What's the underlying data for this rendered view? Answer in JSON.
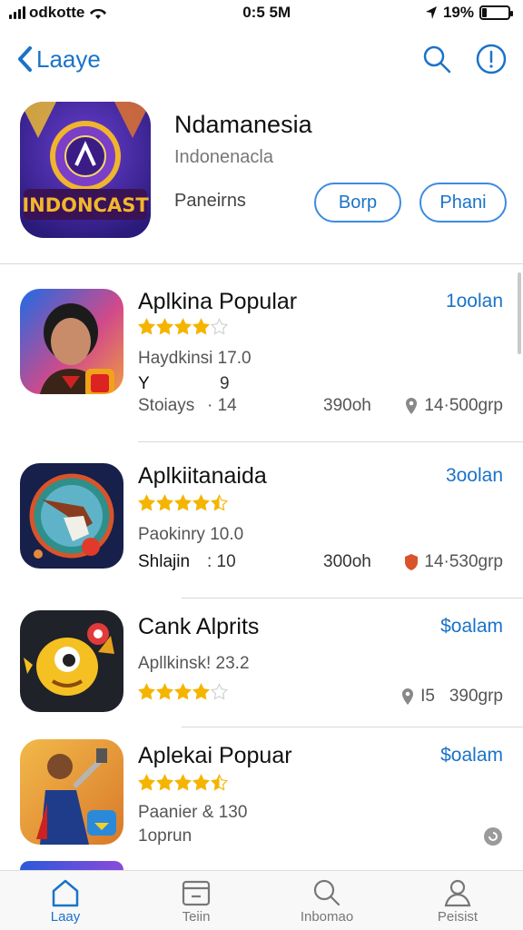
{
  "status": {
    "carrier": "odkotte",
    "time": "0:5 5M",
    "battery": "19%",
    "battery_level": 0.19
  },
  "nav": {
    "back_label": "Laaye"
  },
  "hero": {
    "title": "Ndamanesia",
    "subtitle": "Indonenacla",
    "label": "Paneirns",
    "button_1": "Borp",
    "button_2": "Phani",
    "icon_text": "INDONCAST"
  },
  "rows": [
    {
      "title": "Aplkina Popular",
      "price": "1oolan",
      "rating": 4,
      "line1": "Haydkinsi 17.0",
      "line2a": "Y",
      "line2b": "9",
      "line3a": "Stoiays",
      "line3b": "· 14",
      "size": "390oh",
      "meta": "14·500grp"
    },
    {
      "title": "Aplkiitanaida",
      "price": "3oolan",
      "rating": 4.5,
      "line1": "Paokinry 10.0",
      "line3a": "Shlajin",
      "line3b": ": 10",
      "size": "300oh",
      "meta": "14·530grp"
    },
    {
      "title": "Cank Alprits",
      "price": "$oalam",
      "rating": 4,
      "line1": "Apllkinsk! 23.2",
      "meta": "I5   390grp"
    },
    {
      "title": "Aplekai Popuar",
      "price": "$oalam",
      "rating": 4.5,
      "line1": "Paanier & 130",
      "line2a": "1oprun"
    }
  ],
  "tabs": [
    {
      "label": "Laay",
      "icon": "home-icon"
    },
    {
      "label": "Teiin",
      "icon": "calendar-icon"
    },
    {
      "label": "Inbomao",
      "icon": "search-icon"
    },
    {
      "label": "Peisist",
      "icon": "person-icon"
    }
  ],
  "colors": {
    "accent": "#1a73c8",
    "star": "#f5b400",
    "star_empty": "#cfcfcf"
  }
}
